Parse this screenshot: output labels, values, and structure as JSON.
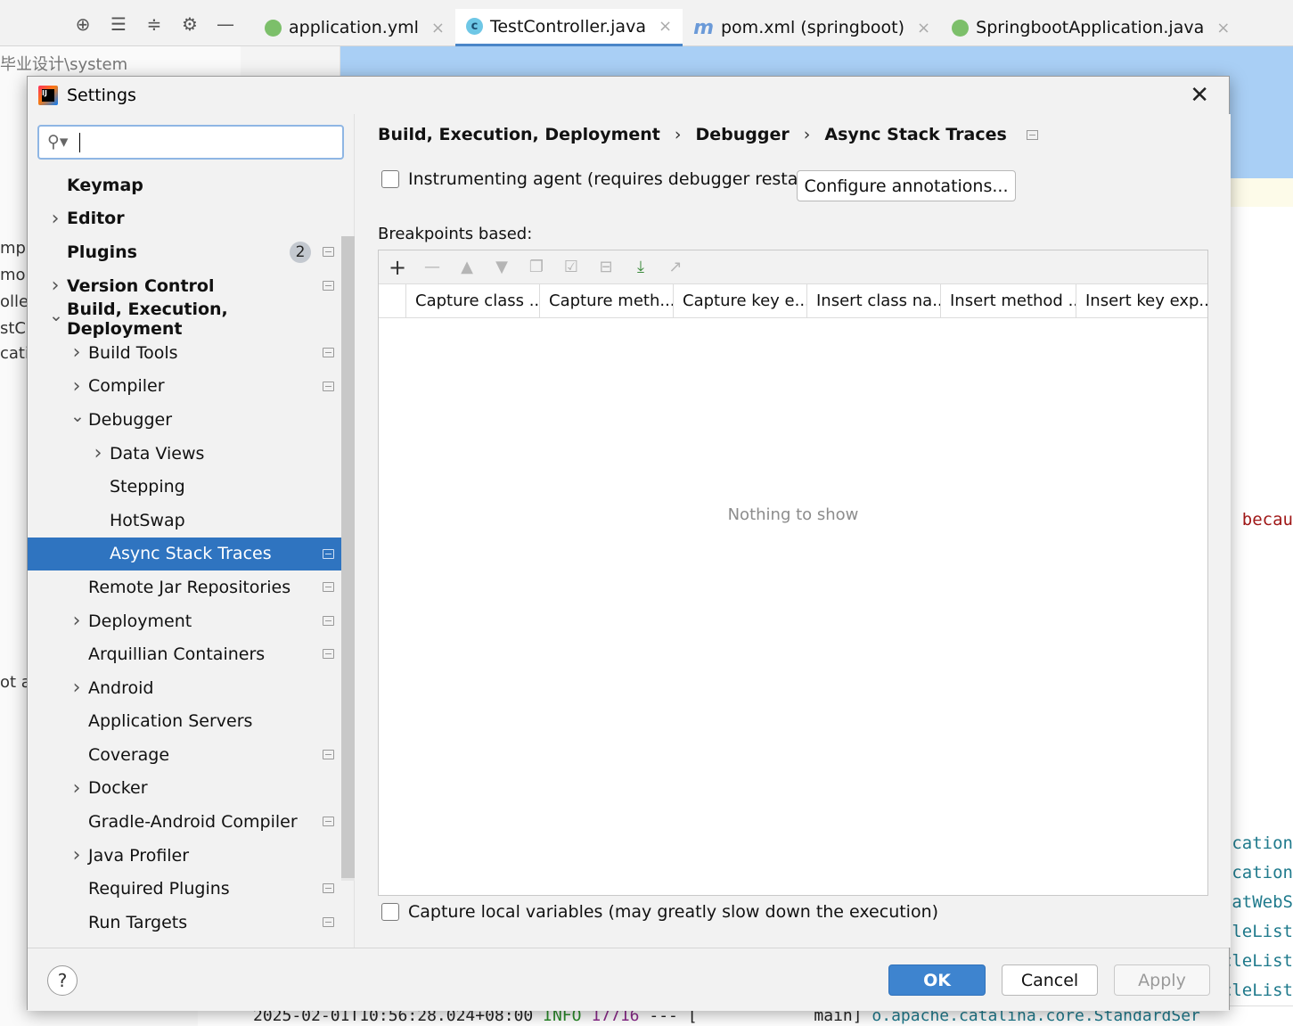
{
  "ide": {
    "toolbar_icons": [
      "crosshair-icon",
      "expand-all-icon",
      "collapse-all-icon",
      "gear-icon",
      "minimize-icon"
    ],
    "tabs": [
      {
        "label": "application.yml",
        "icon": "yaml-leaf-icon",
        "closable": true
      },
      {
        "label": "TestController.java",
        "icon": "class-c-icon",
        "closable": true,
        "active": true
      },
      {
        "label": "pom.xml (springboot)",
        "icon": "maven-m-icon",
        "closable": true
      },
      {
        "label": "SpringbootApplication.java",
        "icon": "spring-app-icon",
        "closable": true
      }
    ],
    "path_fragment": "毕业设计\\system",
    "left_fragments": [
      "mpl",
      "mon",
      "olle",
      "stCo",
      "cati",
      "ot a"
    ],
    "right_fragments": [
      "s becau",
      "cation",
      "cation",
      "catWebS",
      "cleList",
      "cleList",
      "cleList"
    ],
    "console_line": {
      "timestamp": "2025-02-01T10:56:28.024+08:00",
      "level": "INFO",
      "pid": "17716",
      "sep": "--- [",
      "thread": "main]",
      "logger": "o.apache.catalina.core.StandardSer"
    }
  },
  "dialog": {
    "title": "Settings",
    "close_icon": "close-icon",
    "search": {
      "value": "",
      "placeholder": ""
    },
    "tree": [
      {
        "label": "Keymap",
        "bold": true,
        "level": 0,
        "arrow": "",
        "proj": false
      },
      {
        "label": "Editor",
        "bold": true,
        "level": 0,
        "arrow": ">",
        "proj": false
      },
      {
        "label": "Plugins",
        "bold": true,
        "level": 0,
        "arrow": "",
        "badge": "2",
        "proj": true
      },
      {
        "label": "Version Control",
        "bold": true,
        "level": 0,
        "arrow": ">",
        "proj": true
      },
      {
        "label": "Build, Execution, Deployment",
        "bold": true,
        "level": 0,
        "arrow": "v",
        "proj": false
      },
      {
        "label": "Build Tools",
        "bold": false,
        "level": 1,
        "arrow": ">",
        "proj": true
      },
      {
        "label": "Compiler",
        "bold": false,
        "level": 1,
        "arrow": ">",
        "proj": true
      },
      {
        "label": "Debugger",
        "bold": false,
        "level": 1,
        "arrow": "v",
        "proj": false
      },
      {
        "label": "Data Views",
        "bold": false,
        "level": 2,
        "arrow": ">",
        "proj": false
      },
      {
        "label": "Stepping",
        "bold": false,
        "level": 2,
        "arrow": "",
        "proj": false
      },
      {
        "label": "HotSwap",
        "bold": false,
        "level": 2,
        "arrow": "",
        "proj": false
      },
      {
        "label": "Async Stack Traces",
        "bold": false,
        "level": 2,
        "arrow": "",
        "proj": true,
        "selected": true
      },
      {
        "label": "Remote Jar Repositories",
        "bold": false,
        "level": 1,
        "arrow": "",
        "proj": true
      },
      {
        "label": "Deployment",
        "bold": false,
        "level": 1,
        "arrow": ">",
        "proj": true
      },
      {
        "label": "Arquillian Containers",
        "bold": false,
        "level": 1,
        "arrow": "",
        "proj": true
      },
      {
        "label": "Android",
        "bold": false,
        "level": 1,
        "arrow": ">",
        "proj": false
      },
      {
        "label": "Application Servers",
        "bold": false,
        "level": 1,
        "arrow": "",
        "proj": false
      },
      {
        "label": "Coverage",
        "bold": false,
        "level": 1,
        "arrow": "",
        "proj": true
      },
      {
        "label": "Docker",
        "bold": false,
        "level": 1,
        "arrow": ">",
        "proj": false
      },
      {
        "label": "Gradle-Android Compiler",
        "bold": false,
        "level": 1,
        "arrow": "",
        "proj": true
      },
      {
        "label": "Java Profiler",
        "bold": false,
        "level": 1,
        "arrow": ">",
        "proj": false
      },
      {
        "label": "Required Plugins",
        "bold": false,
        "level": 1,
        "arrow": "",
        "proj": true
      },
      {
        "label": "Run Targets",
        "bold": false,
        "level": 1,
        "arrow": "",
        "proj": true
      }
    ],
    "breadcrumb": [
      "Build, Execution, Deployment",
      "Debugger",
      "Async Stack Traces"
    ],
    "breadcrumb_sep": "›",
    "instrumenting_agent": {
      "label": "Instrumenting agent (requires debugger restart)",
      "checked": false
    },
    "configure_button": "Configure annotations...",
    "breakpoints_label": "Breakpoints based:",
    "table_toolbar": [
      {
        "icon": "add-icon",
        "enabled": true
      },
      {
        "icon": "remove-icon",
        "enabled": false
      },
      {
        "icon": "move-up-icon",
        "enabled": false
      },
      {
        "icon": "move-down-icon",
        "enabled": false
      },
      {
        "icon": "copy-icon",
        "enabled": false
      },
      {
        "icon": "check-all-icon",
        "enabled": false
      },
      {
        "icon": "uncheck-all-icon",
        "enabled": false
      },
      {
        "icon": "import-icon",
        "enabled": true
      },
      {
        "icon": "export-icon",
        "enabled": false
      }
    ],
    "columns": [
      "",
      "Capture class ...",
      "Capture meth...",
      "Capture key e...",
      "Insert class na...",
      "Insert method ...",
      "Insert key exp..."
    ],
    "empty_text": "Nothing to show",
    "capture_local": {
      "label": "Capture local variables (may greatly slow down the execution)",
      "checked": false
    },
    "help_icon": "help-icon",
    "buttons": {
      "ok": "OK",
      "cancel": "Cancel",
      "apply": "Apply"
    },
    "colors": {
      "selection": "#2f74c0",
      "ok_button": "#3e84cf",
      "search_border": "#8fb6e4"
    }
  }
}
